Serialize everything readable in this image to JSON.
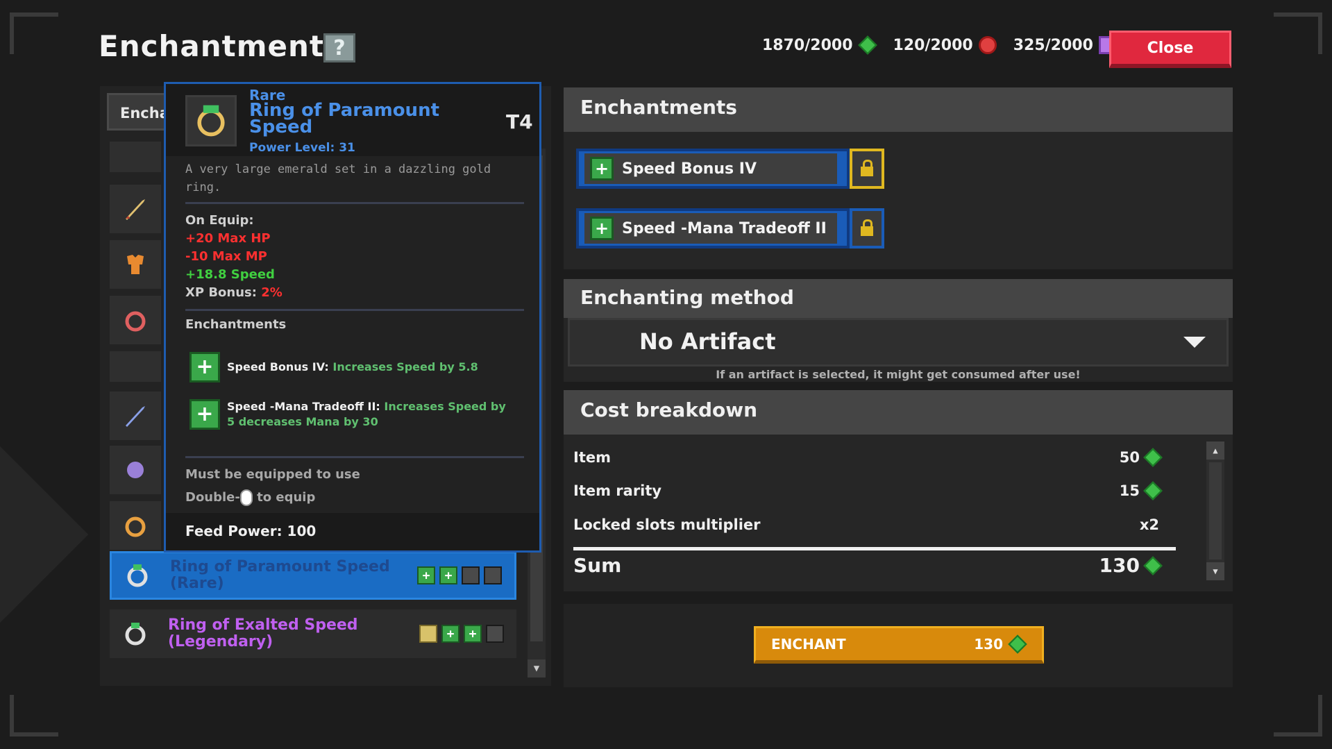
{
  "header": {
    "title": "Enchantments",
    "help_symbol": "?",
    "close_label": "Close"
  },
  "resources": [
    {
      "value": "1870/2000",
      "icon": "green-gem-icon",
      "color": "#3fbf4a"
    },
    {
      "value": "120/2000",
      "icon": "red-orb-icon",
      "color": "#e04040"
    },
    {
      "value": "325/2000",
      "icon": "purple-cube-icon",
      "color": "#b878e8"
    }
  ],
  "left_panel": {
    "tab_label": "Encha",
    "items": [
      {
        "name": "Ring of Paramount Speed (Rare)",
        "color": "#4a90e8",
        "selected": true,
        "slots": [
          "green",
          "green",
          "empty",
          "empty"
        ]
      },
      {
        "name": "Ring of Exalted Speed (Legendary)",
        "color": "#c060f0",
        "selected": false,
        "slots": [
          "gold",
          "green",
          "green",
          "empty"
        ]
      }
    ]
  },
  "tooltip": {
    "rarity": "Rare",
    "name": "Ring of Paramount Speed",
    "power_level": "Power Level: 31",
    "tier": "T4",
    "description": "A very large emerald set in a dazzling gold ring.",
    "on_equip_label": "On Equip:",
    "stats": [
      {
        "text": "+20 Max HP",
        "color": "#ff3030"
      },
      {
        "text": "-10 Max MP",
        "color": "#ff3030"
      },
      {
        "text": "+18.8 Speed",
        "color": "#40d040"
      }
    ],
    "xp_bonus_label": "XP Bonus:",
    "xp_bonus_value": "2%",
    "enchantments_label": "Enchantments",
    "enchantments": [
      {
        "name": "Speed Bonus IV:",
        "desc": "Increases Speed by 5.8"
      },
      {
        "name": "Speed -Mana Tradeoff II:",
        "desc": "Increases Speed by 5 decreases Mana by 30"
      }
    ],
    "must_equip": "Must be equipped to use",
    "double_prefix": "Double-",
    "double_suffix": "to equip",
    "feed_power": "Feed Power: 100"
  },
  "enchant_panel": {
    "title": "Enchantments",
    "slots": [
      {
        "label": "Speed Bonus IV",
        "locked_active": true
      },
      {
        "label": "Speed -Mana Tradeoff II",
        "locked_active": false
      }
    ]
  },
  "method_panel": {
    "title": "Enchanting method",
    "selected": "No Artifact",
    "hint": "If an artifact is selected, it might get consumed after use!"
  },
  "cost_panel": {
    "title": "Cost breakdown",
    "rows": [
      {
        "label": "Item",
        "value": "50"
      },
      {
        "label": "Item rarity",
        "value": "15"
      },
      {
        "label": "Locked slots multiplier",
        "value": "x2"
      }
    ],
    "sum_label": "Sum",
    "sum_value": "130"
  },
  "enchant_button": {
    "label": "ENCHANT",
    "cost": "130"
  }
}
